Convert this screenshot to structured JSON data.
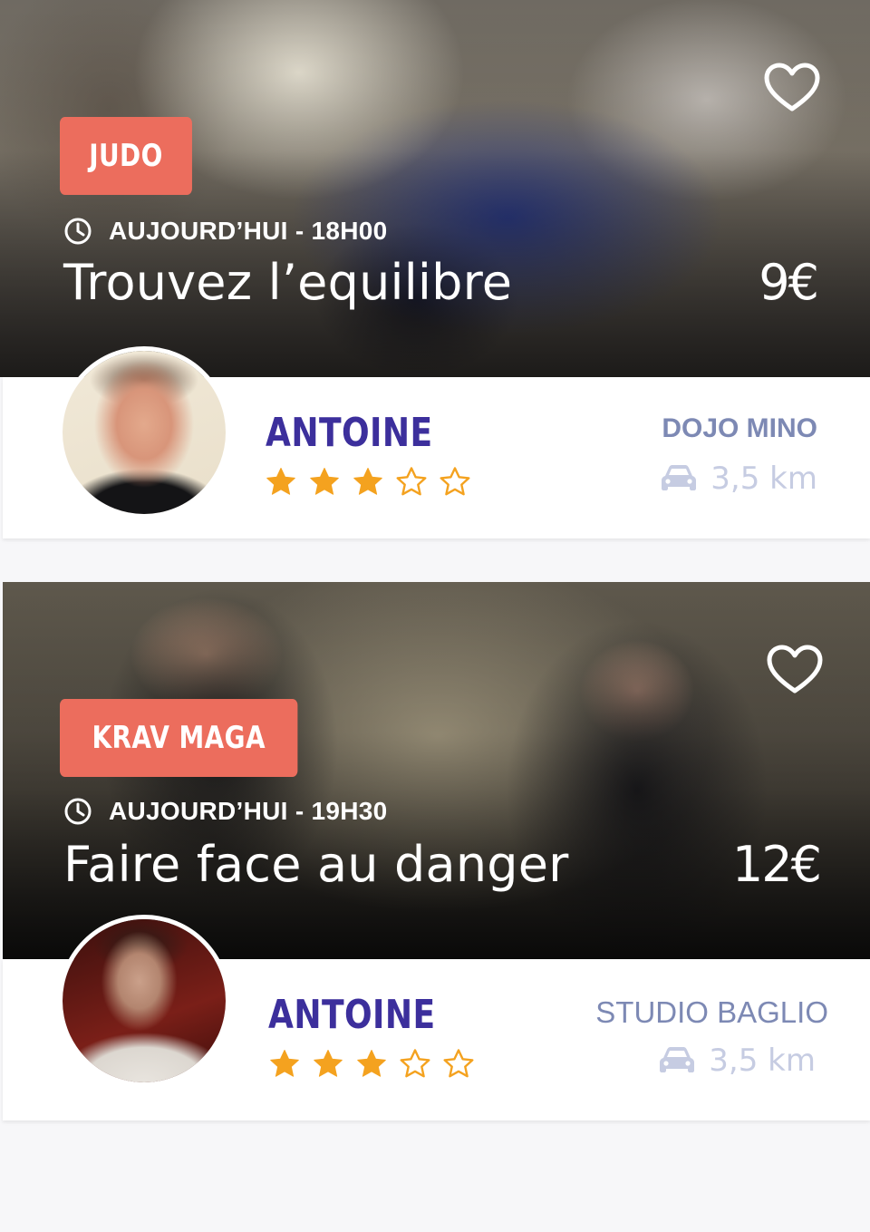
{
  "classes": [
    {
      "category": "JUDO",
      "when": "AUJOURD’HUI - 18H00",
      "title": "Trouvez l’equilibre",
      "price": "9€",
      "coach": "ANTOINE",
      "rating": 3,
      "rating_max": 5,
      "venue": "DOJO MINO",
      "distance": "3,5 km"
    },
    {
      "category": "KRAV MAGA",
      "when": "AUJOURD’HUI - 19H30",
      "title": "Faire face au danger",
      "price": "12€",
      "coach": "ANTOINE",
      "rating": 3,
      "rating_max": 5,
      "venue": "STUDIO BAGLIO",
      "distance": "3,5 km"
    }
  ],
  "icons": {
    "favorite": "heart-outline-icon",
    "time": "clock-icon",
    "travel": "car-icon",
    "rating_filled": "star-filled-icon",
    "rating_empty": "star-outline-icon"
  },
  "colors": {
    "tag_background": "#ec6d5d",
    "coach_name": "#3c2f9c",
    "venue": "#7d89b4",
    "distance": "#c6cce2",
    "star": "#f4a21f"
  }
}
